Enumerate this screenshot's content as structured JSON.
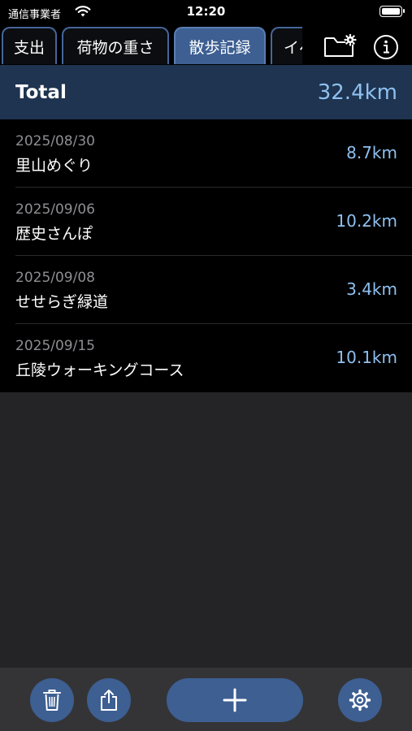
{
  "status_bar": {
    "carrier": "通信事業者",
    "time": "12:20"
  },
  "tabs": [
    {
      "label": "支出",
      "active": false
    },
    {
      "label": "荷物の重さ",
      "active": false
    },
    {
      "label": "散歩記録",
      "active": true
    },
    {
      "label": "イベ",
      "active": false
    }
  ],
  "header_icons": [
    "folder-gear-icon",
    "info-icon"
  ],
  "total": {
    "label": "Total",
    "value": "32.4km"
  },
  "records": [
    {
      "date": "2025/08/30",
      "name": "里山めぐり",
      "distance": "8.7km"
    },
    {
      "date": "2025/09/06",
      "name": "歴史さんぽ",
      "distance": "10.2km"
    },
    {
      "date": "2025/09/08",
      "name": "せせらぎ緑道",
      "distance": "3.4km"
    },
    {
      "date": "2025/09/15",
      "name": "丘陵ウォーキングコース",
      "distance": "10.1km"
    }
  ],
  "toolbar_icons": [
    "trash-icon",
    "share-icon",
    "plus-icon",
    "gear-icon"
  ],
  "colors": {
    "accent": "#3d5f92",
    "value_text": "#8ec0f0",
    "total_background": "#1e3450",
    "list_background": "#000000",
    "empty_background": "#242426"
  }
}
